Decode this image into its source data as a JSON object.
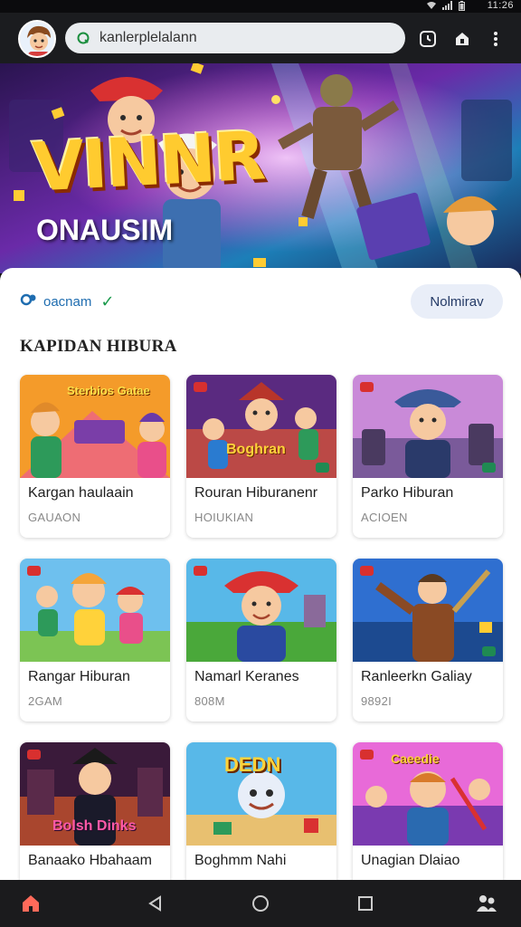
{
  "status_bar": {
    "time": "11:26",
    "icons": [
      "wifi-icon",
      "signal-icon",
      "battery-icon"
    ]
  },
  "browser": {
    "url": "kanlerplelalann",
    "icons": [
      "tabs-icon",
      "lock-share-icon",
      "more-icon"
    ]
  },
  "hero": {
    "title": "VINNR",
    "subtitle": "ONAUSIM"
  },
  "account": {
    "name": "oacnam",
    "button_label": "Nolmirav"
  },
  "section": {
    "title": "KAPIDAN HIBURA"
  },
  "cards": [
    {
      "name": "Kargan haulaain",
      "meta": "GAUAON"
    },
    {
      "name": "Rouran Hiburanenr",
      "meta": "HOIUKIAN"
    },
    {
      "name": "Parko Hiburan",
      "meta": "ACIOEN"
    },
    {
      "name": "Rangar Hiburan",
      "meta": "2GAM"
    },
    {
      "name": "Namarl Keranes",
      "meta": "808M"
    },
    {
      "name": "Ranleerkn Galiay",
      "meta": "9892I"
    },
    {
      "name": "Banaako Hbahaam",
      "meta": ""
    },
    {
      "name": "Boghmm Nahi",
      "meta": ""
    },
    {
      "name": "Unagian Dlaiao",
      "meta": ""
    }
  ],
  "thumb_titles": [
    "Sterbios Gatae",
    "Boghran",
    "",
    "",
    "",
    "",
    "Bolsh Dinks",
    "DEDN",
    "Caeedie"
  ],
  "colors": {
    "accent": "#1f6db0",
    "check": "#1a9a4b",
    "nav_bg": "#1b1b1d"
  }
}
